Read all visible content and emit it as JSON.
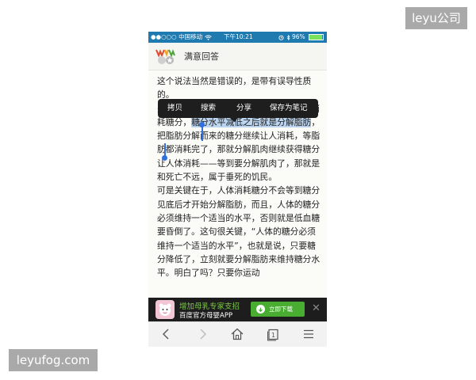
{
  "watermarks": {
    "top_right": "leyu公司",
    "bottom_left": "leyufog.com"
  },
  "status_bar": {
    "carrier": "●●○○○ 中国移动",
    "time": "下午10:21",
    "battery_text": "96%",
    "battery_level": 0.96
  },
  "header": {
    "title": "满意回答"
  },
  "context_menu": {
    "copy": "拷贝",
    "search": "搜索",
    "share": "分享",
    "save_note": "保存为笔记"
  },
  "article": {
    "p1": "这个说法当然是错误的，是带有误导性质的。",
    "p2_before": "先搞清人体消耗能量的次序：首先是直接消耗糖分，",
    "p2_selected": "糖分水平减低之后就是分解脂肪",
    "p2_after": "，把脂肪分解而来的糖分继续让人消耗，等脂肪都消耗完了，那就分解肌肉继续获得糖分让人体消耗——等到要分解肌肉了，那就是和死亡不远，属于垂死的饥民。",
    "p3": "可是关键在于，人体消耗糖分不会等到糖分见底后才开始分解脂肪，而且，人体的糖分必须维持一个适当的水平，否则就是低血糖要昏倒了。这句很关键，“人体的糖分必须维持一个适当的水平”，也就是说，只要糖分降低了，立刻就要分解脂肪来维持糖分水平。明白了吗？只要你运动"
  },
  "ad": {
    "line1": "增加母乳专家支招",
    "line2": "百度官方母婴APP",
    "button": "立即下载"
  },
  "colors": {
    "status_bar": "#1f7ab0",
    "selection": "#bcd6f2",
    "accent_green": "#49ad32",
    "handle": "#2f6fe0"
  }
}
